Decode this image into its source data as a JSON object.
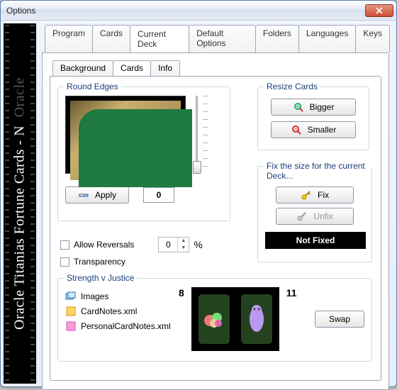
{
  "window": {
    "title": "Options"
  },
  "sidebar": {
    "text_main": "Oracle Titanias Fortune Cards - N",
    "text_shadow": "Oracle"
  },
  "tabs_main": {
    "items": [
      "Program",
      "Cards",
      "Current Deck",
      "Default Options",
      "Folders",
      "Languages",
      "Keys"
    ],
    "active_index": 2
  },
  "tabs_sub": {
    "items": [
      "Background",
      "Cards",
      "Info"
    ],
    "active_index": 1
  },
  "round_edges": {
    "title": "Round Edges",
    "apply_label": "Apply",
    "value": "0"
  },
  "resize": {
    "title": "Resize Cards",
    "bigger_label": "Bigger",
    "smaller_label": "Smaller"
  },
  "options": {
    "allow_reversals_label": "Allow Reversals",
    "transparency_label": "Transparency",
    "spinner_value": "0",
    "percent": "%"
  },
  "fix": {
    "title": "Fix the size for the current Deck...",
    "fix_label": "Fix",
    "unfix_label": "Unfix",
    "status": "Not Fixed"
  },
  "strength": {
    "title": "Strength v Justice",
    "left_num": "8",
    "right_num": "11",
    "swap_label": "Swap",
    "files": {
      "images": "Images",
      "cardnotes": "CardNotes.xml",
      "personal": "PersonalCardNotes.xml"
    }
  }
}
